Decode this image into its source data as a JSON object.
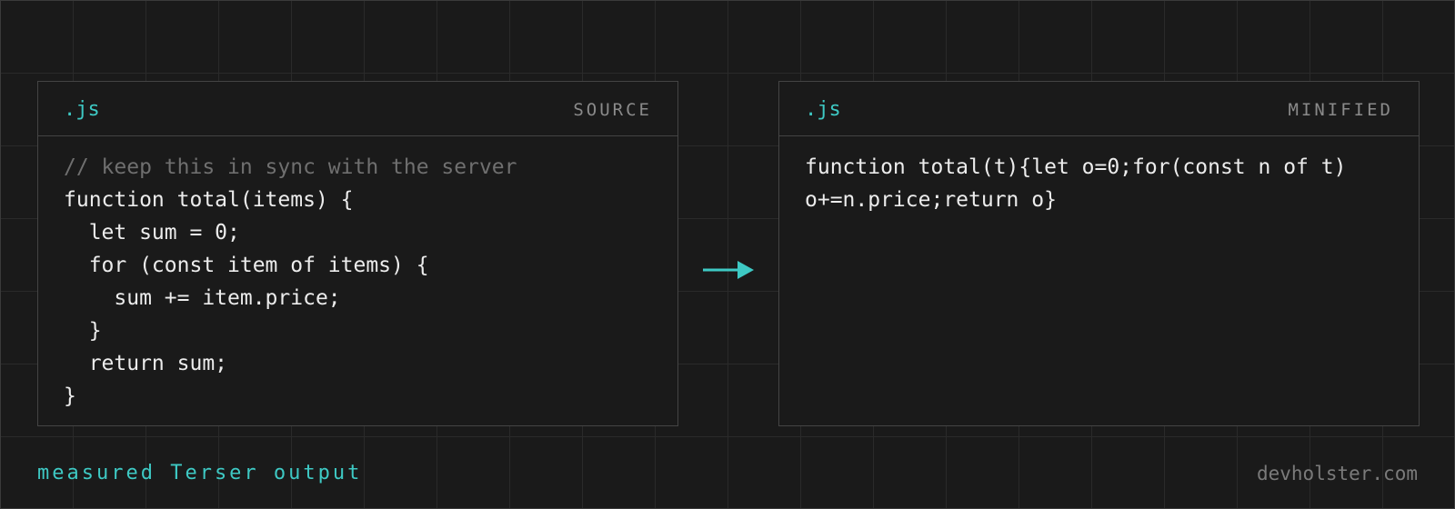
{
  "source_panel": {
    "extension": ".js",
    "kind_label": "SOURCE",
    "lines": [
      {
        "text": "// keep this in sync with the server",
        "type": "comment"
      },
      {
        "text": "function total(items) {",
        "type": "code"
      },
      {
        "text": "  let sum = 0;",
        "type": "code"
      },
      {
        "text": "  for (const item of items) {",
        "type": "code"
      },
      {
        "text": "    sum += item.price;",
        "type": "code"
      },
      {
        "text": "  }",
        "type": "code"
      },
      {
        "text": "  return sum;",
        "type": "code"
      },
      {
        "text": "}",
        "type": "code"
      }
    ]
  },
  "minified_panel": {
    "extension": ".js",
    "kind_label": "MINIFIED",
    "lines": [
      {
        "text": "function total(t){let o=0;for(const n of t)",
        "type": "code"
      },
      {
        "text": "o+=n.price;return o}",
        "type": "code"
      }
    ]
  },
  "arrow": {
    "icon": "arrow-right-icon",
    "color": "#3ec9c4"
  },
  "footer": {
    "caption": "measured Terser output",
    "site": "devholster.com"
  },
  "colors": {
    "accent": "#3ec9c4",
    "comment": "#6f6f6f",
    "text": "#ececec",
    "muted": "#8a8a8a"
  }
}
